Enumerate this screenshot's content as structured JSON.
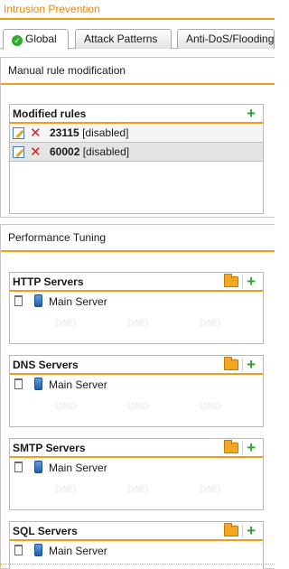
{
  "header": {
    "title": "Intrusion Prevention"
  },
  "tabs": [
    {
      "label": "Global",
      "active": true
    },
    {
      "label": "Attack Patterns"
    },
    {
      "label": "Anti-DoS/Flooding"
    }
  ],
  "manual_section": {
    "title": "Manual rule modification",
    "modified_rules": {
      "title": "Modified rules",
      "rules": [
        {
          "id": "23115",
          "status": "[disabled]"
        },
        {
          "id": "60002",
          "status": "[disabled]"
        }
      ]
    }
  },
  "performance_section": {
    "title": "Performance Tuning",
    "panels": [
      {
        "title": "HTTP Servers",
        "server": "Main Server"
      },
      {
        "title": "DNS Servers",
        "server": "Main Server"
      },
      {
        "title": "SMTP Servers",
        "server": "Main Server"
      },
      {
        "title": "SQL Servers",
        "server": "Main Server"
      }
    ],
    "watermark": "DND"
  },
  "colors": {
    "accent": "#f39c1c",
    "title": "#e8870c",
    "add": "#2f9e2f",
    "delete": "#d42020"
  }
}
